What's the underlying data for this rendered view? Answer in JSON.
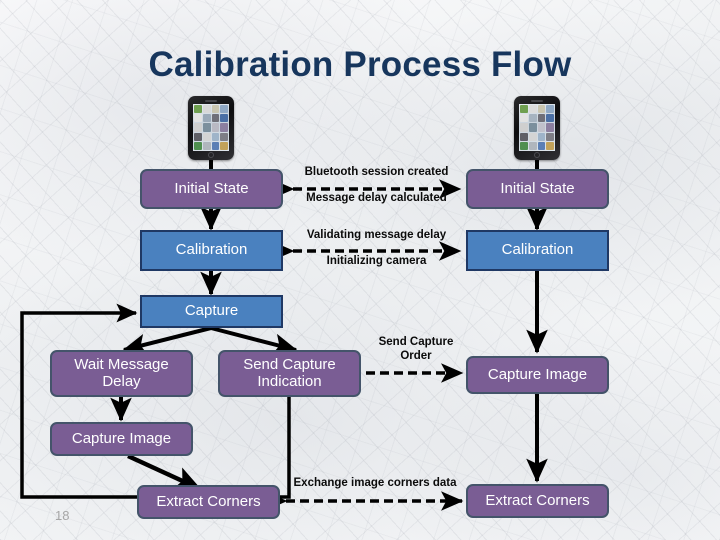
{
  "slide": {
    "title": "Calibration Process Flow",
    "page_number": "18",
    "title_color": "#17365D",
    "purple_node_color": "#7A5D94",
    "blue_node_color": "#4A81BF",
    "node_border_color": "#44546A",
    "connector_color": "#000000"
  },
  "devices": [
    {
      "name": "left-smartphone"
    },
    {
      "name": "right-smartphone"
    }
  ],
  "nodes": {
    "left": [
      {
        "id": "left-initial-state",
        "label": "Initial State",
        "style": "purple"
      },
      {
        "id": "left-calibration",
        "label": "Calibration",
        "style": "blue"
      },
      {
        "id": "left-capture",
        "label": "Capture",
        "style": "blue"
      },
      {
        "id": "left-wait-message-delay",
        "label": "Wait Message\nDelay",
        "style": "purple"
      },
      {
        "id": "left-send-capture-indication",
        "label": "Send Capture\nIndication",
        "style": "purple"
      },
      {
        "id": "left-capture-image",
        "label": "Capture Image",
        "style": "purple"
      },
      {
        "id": "left-extract-corners",
        "label": "Extract Corners",
        "style": "purple"
      }
    ],
    "right": [
      {
        "id": "right-initial-state",
        "label": "Initial State",
        "style": "purple"
      },
      {
        "id": "right-calibration",
        "label": "Calibration",
        "style": "blue"
      },
      {
        "id": "right-capture-image",
        "label": "Capture Image",
        "style": "purple"
      },
      {
        "id": "right-extract-corners",
        "label": "Extract Corners",
        "style": "purple"
      }
    ]
  },
  "edge_labels": [
    {
      "id": "bluetooth-session-created",
      "text": "Bluetooth session created"
    },
    {
      "id": "message-delay-calculated",
      "text": "Message delay calculated"
    },
    {
      "id": "validating-message-delay",
      "text": "Validating message delay"
    },
    {
      "id": "initializing-camera",
      "text": "Initializing camera"
    },
    {
      "id": "send-capture-order-line1",
      "text": "Send Capture"
    },
    {
      "id": "send-capture-order-line2",
      "text": "Order"
    },
    {
      "id": "exchange-image-corners-data",
      "text": "Exchange image corners data"
    }
  ]
}
